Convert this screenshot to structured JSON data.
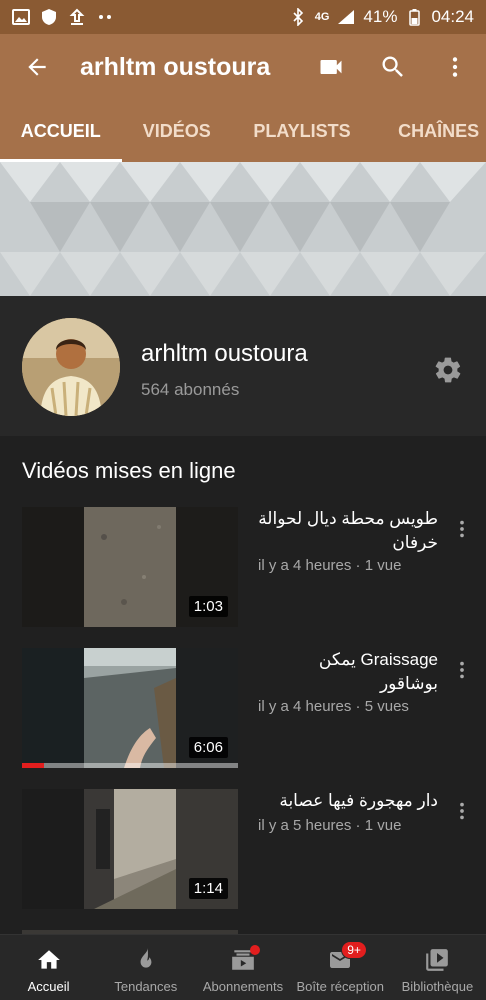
{
  "status_bar": {
    "battery": "41%",
    "time": "04:24",
    "network": "4G"
  },
  "app_bar": {
    "title": "arhltm oustoura",
    "back_icon": "arrow-back-icon",
    "actions": [
      "video-camera-icon",
      "search-icon",
      "more-vert-icon"
    ]
  },
  "tabs": [
    {
      "label": "ACCUEIL",
      "active": true
    },
    {
      "label": "VIDÉOS",
      "active": false
    },
    {
      "label": "PLAYLISTS",
      "active": false
    },
    {
      "label": "CHAÎNES",
      "active": false
    }
  ],
  "channel": {
    "name": "arhltm oustoura",
    "subscribers": "564 abonnés"
  },
  "section": {
    "title": "Vidéos mises en ligne"
  },
  "videos": [
    {
      "title": "طويس محطة ديال لحوالة خرفان",
      "meta": "il y a 4 heures · 1 vue",
      "duration": "1:03",
      "progress": 0
    },
    {
      "title": "Graissage يمكن بوشاقور",
      "meta": "il y a 4 heures · 5 vues",
      "duration": "6:06",
      "progress": 0.1
    },
    {
      "title": "دار مهجورة فيها عصابة",
      "meta": "il y a 5 heures · 1 vue",
      "duration": "1:14",
      "progress": 0
    }
  ],
  "bottom_nav": [
    {
      "label": "Accueil",
      "icon": "home-icon",
      "active": true
    },
    {
      "label": "Tendances",
      "icon": "flame-icon",
      "active": false
    },
    {
      "label": "Abonnements",
      "icon": "subscriptions-icon",
      "active": false,
      "dot": true
    },
    {
      "label": "Boîte réception",
      "icon": "mail-icon",
      "active": false,
      "badge": "9+"
    },
    {
      "label": "Bibliothèque",
      "icon": "library-icon",
      "active": false
    }
  ],
  "colors": {
    "status_bar": "#8a5a33",
    "app_bar": "#a5714a",
    "background": "#202020",
    "accent_red": "#e21e1e"
  }
}
